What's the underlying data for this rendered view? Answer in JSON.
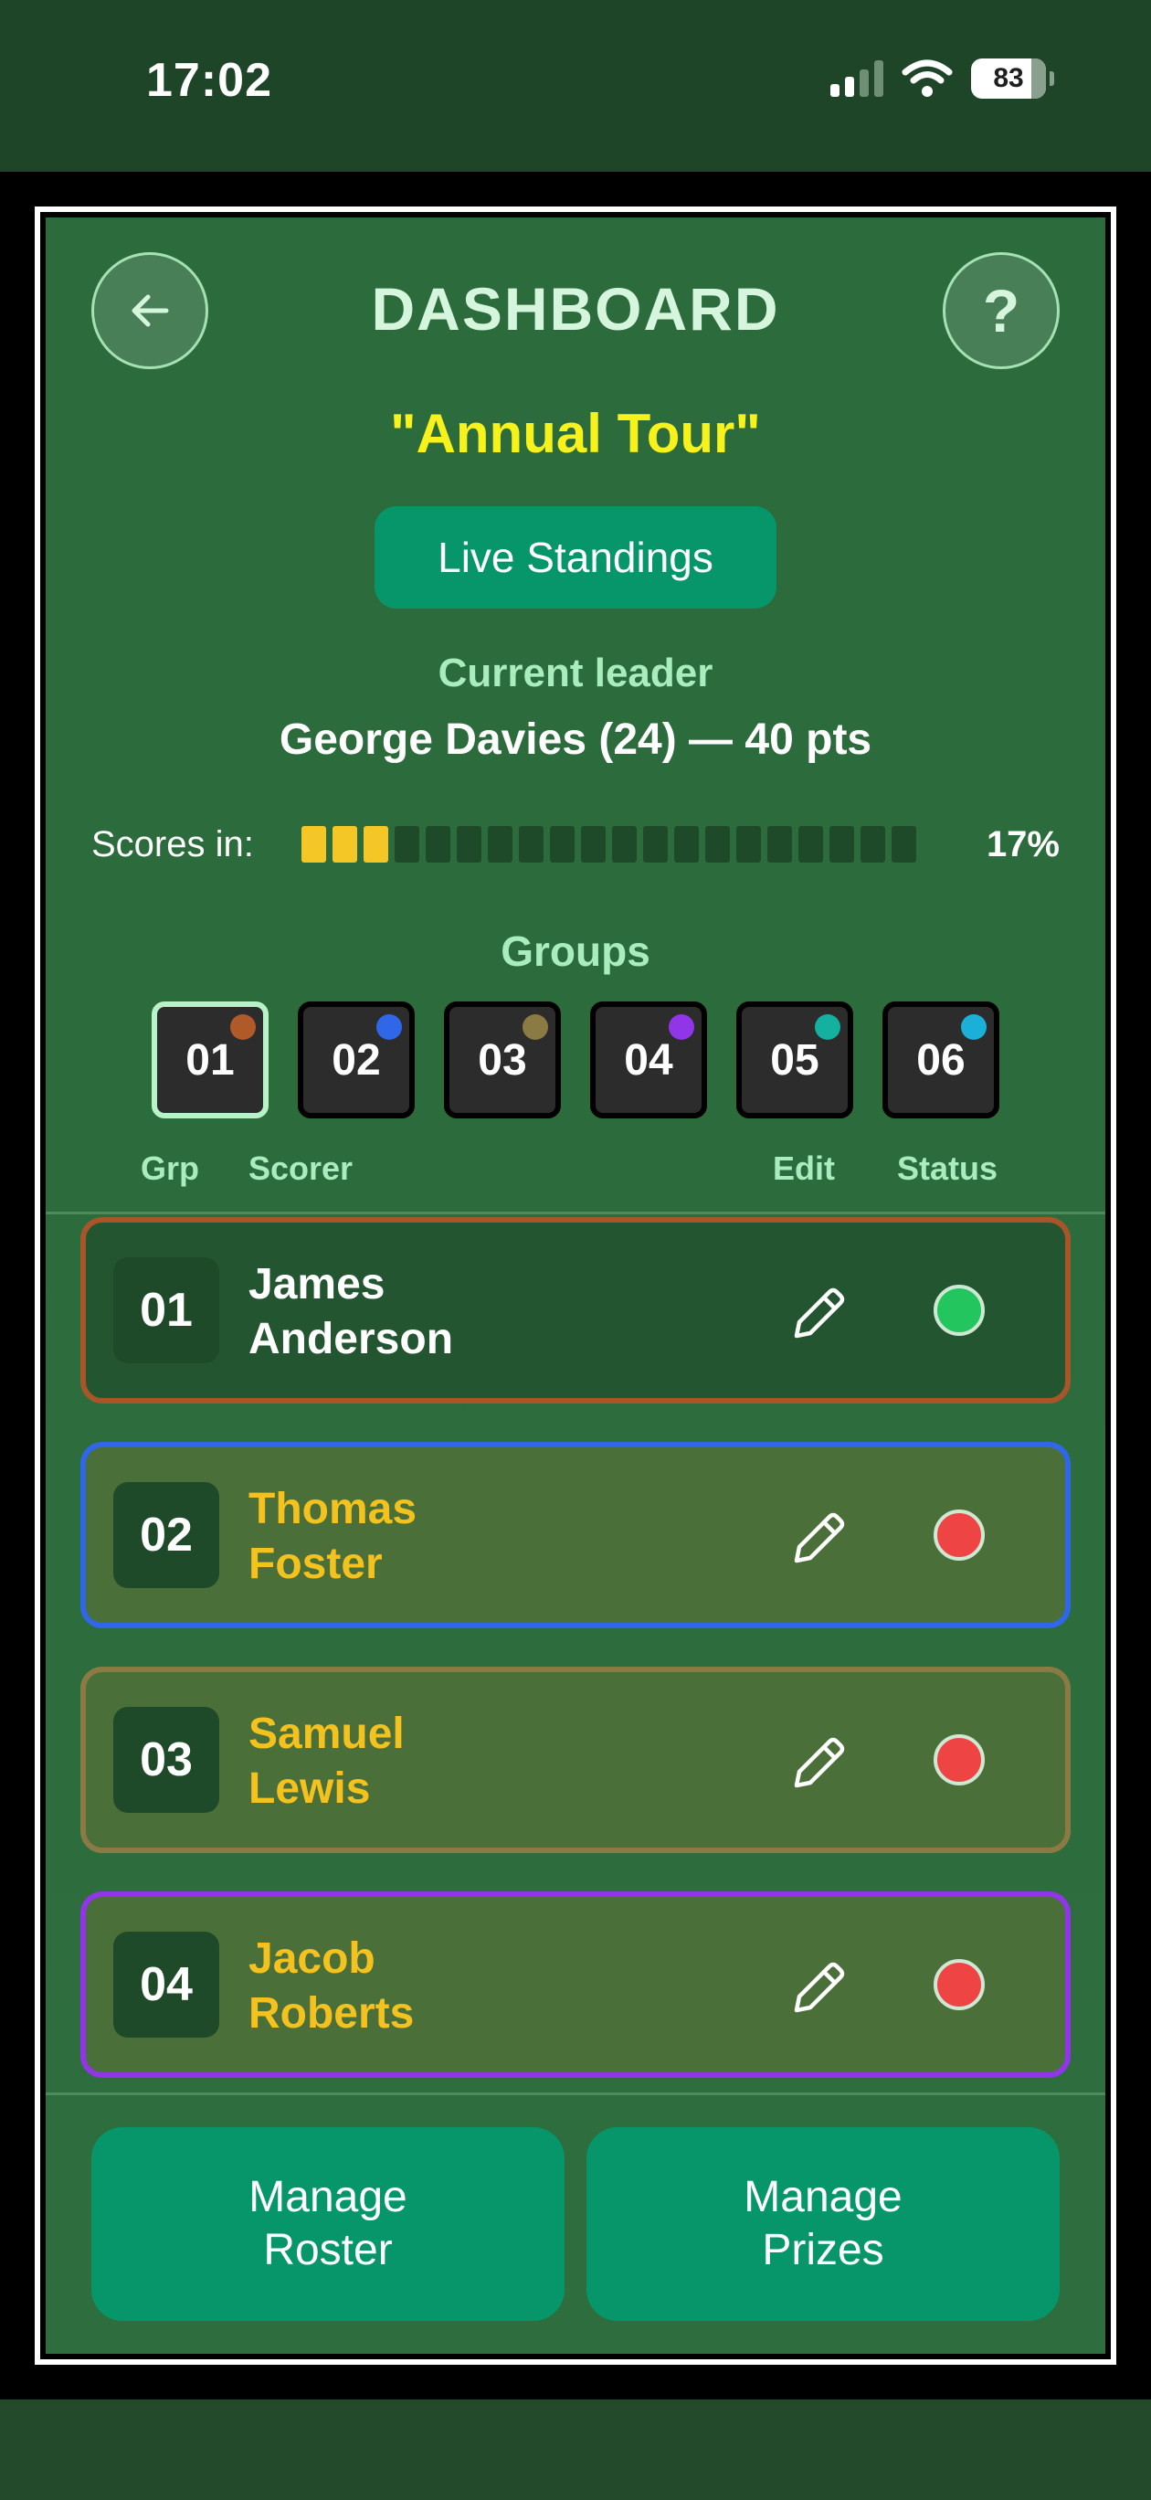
{
  "status_bar": {
    "time": "17:02",
    "battery": "83",
    "icons": [
      "signal-icon",
      "wifi-icon",
      "battery-icon"
    ]
  },
  "header": {
    "title": "DASHBOARD",
    "back_icon": "arrow-left-icon",
    "help_label": "?"
  },
  "event": {
    "name": "\"Annual Tour\""
  },
  "live_button": {
    "label": "Live Standings"
  },
  "leader": {
    "label": "Current leader",
    "value": "George Davies (24) — 40 pts"
  },
  "scores": {
    "label": "Scores in:",
    "percent": "17%",
    "filled_segments": 3,
    "total_segments": 20,
    "colors": {
      "on": "#f4c726",
      "off": "#1f4a2a"
    }
  },
  "groups": {
    "title": "Groups",
    "selected": "01",
    "items": [
      {
        "label": "01",
        "color": "#b05a2a"
      },
      {
        "label": "02",
        "color": "#2f67e8"
      },
      {
        "label": "03",
        "color": "#8c7a45"
      },
      {
        "label": "04",
        "color": "#9035e8"
      },
      {
        "label": "05",
        "color": "#14b0a0"
      },
      {
        "label": "06",
        "color": "#1ab0d8"
      }
    ]
  },
  "columns": {
    "grp": "Grp",
    "scorer": "Scorer",
    "edit": "Edit",
    "status": "Status"
  },
  "rows": [
    {
      "num": "01",
      "first": "James",
      "last": "Anderson",
      "name_color": "#ffffff",
      "bg": "#235630",
      "border": "#a8552a",
      "status_color": "#22c55e"
    },
    {
      "num": "02",
      "first": "Thomas",
      "last": "Foster",
      "name_color": "#f4c21f",
      "bg": "#4b6f38",
      "border": "#2f67e8",
      "status_color": "#ef4444"
    },
    {
      "num": "03",
      "first": "Samuel",
      "last": "Lewis",
      "name_color": "#f4c21f",
      "bg": "#4b6f38",
      "border": "#8c7a45",
      "status_color": "#ef4444"
    },
    {
      "num": "04",
      "first": "Jacob",
      "last": "Roberts",
      "name_color": "#f4c21f",
      "bg": "#4b6f38",
      "border": "#9035e8",
      "status_color": "#ef4444"
    }
  ],
  "row_icons": {
    "edit": "pencil-icon",
    "status": "status-dot-icon"
  },
  "footer": {
    "roster": {
      "line1": "Manage",
      "line2": "Roster"
    },
    "prizes": {
      "line1": "Manage",
      "line2": "Prizes"
    }
  }
}
